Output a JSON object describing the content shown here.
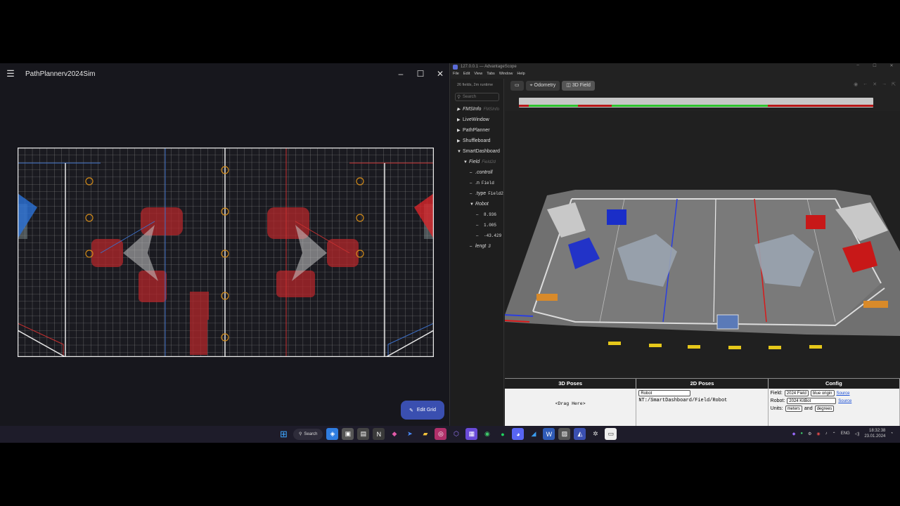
{
  "pathplanner": {
    "title": "PathPlannerv2024Sim",
    "edit_grid_label": "Edit Grid"
  },
  "advantagescope": {
    "window_title": "127.0.0.1 — AdvantageScope",
    "menu": [
      "File",
      "Edit",
      "View",
      "Tabs",
      "Window",
      "Help"
    ],
    "field_count": "26 fields, 2m runtime",
    "search_placeholder": "Search",
    "tree": [
      {
        "label": "FMSInfo",
        "sub": "FMSInfo",
        "arrow": "▶",
        "italic": true,
        "indent": 0
      },
      {
        "label": "LiveWindow",
        "sub": "",
        "arrow": "▶",
        "italic": false,
        "indent": 0
      },
      {
        "label": "PathPlanner",
        "sub": "",
        "arrow": "▶",
        "italic": false,
        "indent": 0
      },
      {
        "label": "Shuffleboard",
        "sub": "",
        "arrow": "▶",
        "italic": false,
        "indent": 0
      },
      {
        "label": "SmartDashboard",
        "sub": "",
        "arrow": "▼",
        "italic": false,
        "indent": 0
      },
      {
        "label": "Field",
        "sub": "Field2d",
        "arrow": "▼",
        "italic": true,
        "indent": 1
      },
      {
        "label": ".controll",
        "sub": "",
        "arrow": "–",
        "italic": true,
        "indent": 2
      },
      {
        "label": ".n",
        "sub": "Field",
        "arrow": "–",
        "italic": false,
        "indent": 2
      },
      {
        "label": ".type",
        "sub": "Field2d",
        "arrow": "–",
        "italic": false,
        "indent": 2
      },
      {
        "label": "Robot",
        "sub": "",
        "arrow": "▼",
        "italic": true,
        "indent": 2
      },
      {
        "label": "",
        "sub": "8.936",
        "arrow": "–",
        "italic": false,
        "indent": 3
      },
      {
        "label": "",
        "sub": "1.005",
        "arrow": "–",
        "italic": false,
        "indent": 3
      },
      {
        "label": "",
        "sub": "-43.429",
        "arrow": "–",
        "italic": false,
        "indent": 3
      },
      {
        "label": "lengt",
        "sub": "3",
        "arrow": "–",
        "italic": true,
        "indent": 2
      }
    ],
    "tabs": {
      "odometry": "Odometry",
      "field3d": "3D Field"
    },
    "config": {
      "poses3d_header": "3D Poses",
      "poses2d_header": "2D Poses",
      "config_header": "Config",
      "drag_here": "<Drag Here>",
      "pose2d_select": "Robot",
      "pose2d_key": "NT:/SmartDashboard/Field/Robot",
      "field_label": "Field:",
      "field_value": "2024 Field",
      "origin_value": "blue origin",
      "source_label": "Source",
      "robot_label": "Robot:",
      "robot_value": "2024 KitBot",
      "units_label": "Units:",
      "units_value": "meters",
      "and_label": "and",
      "angle_units": "degrees"
    }
  },
  "taskbar": {
    "search_label": "Search",
    "language": "ENG",
    "time": "18:32:38",
    "date": "23.01.2024"
  }
}
